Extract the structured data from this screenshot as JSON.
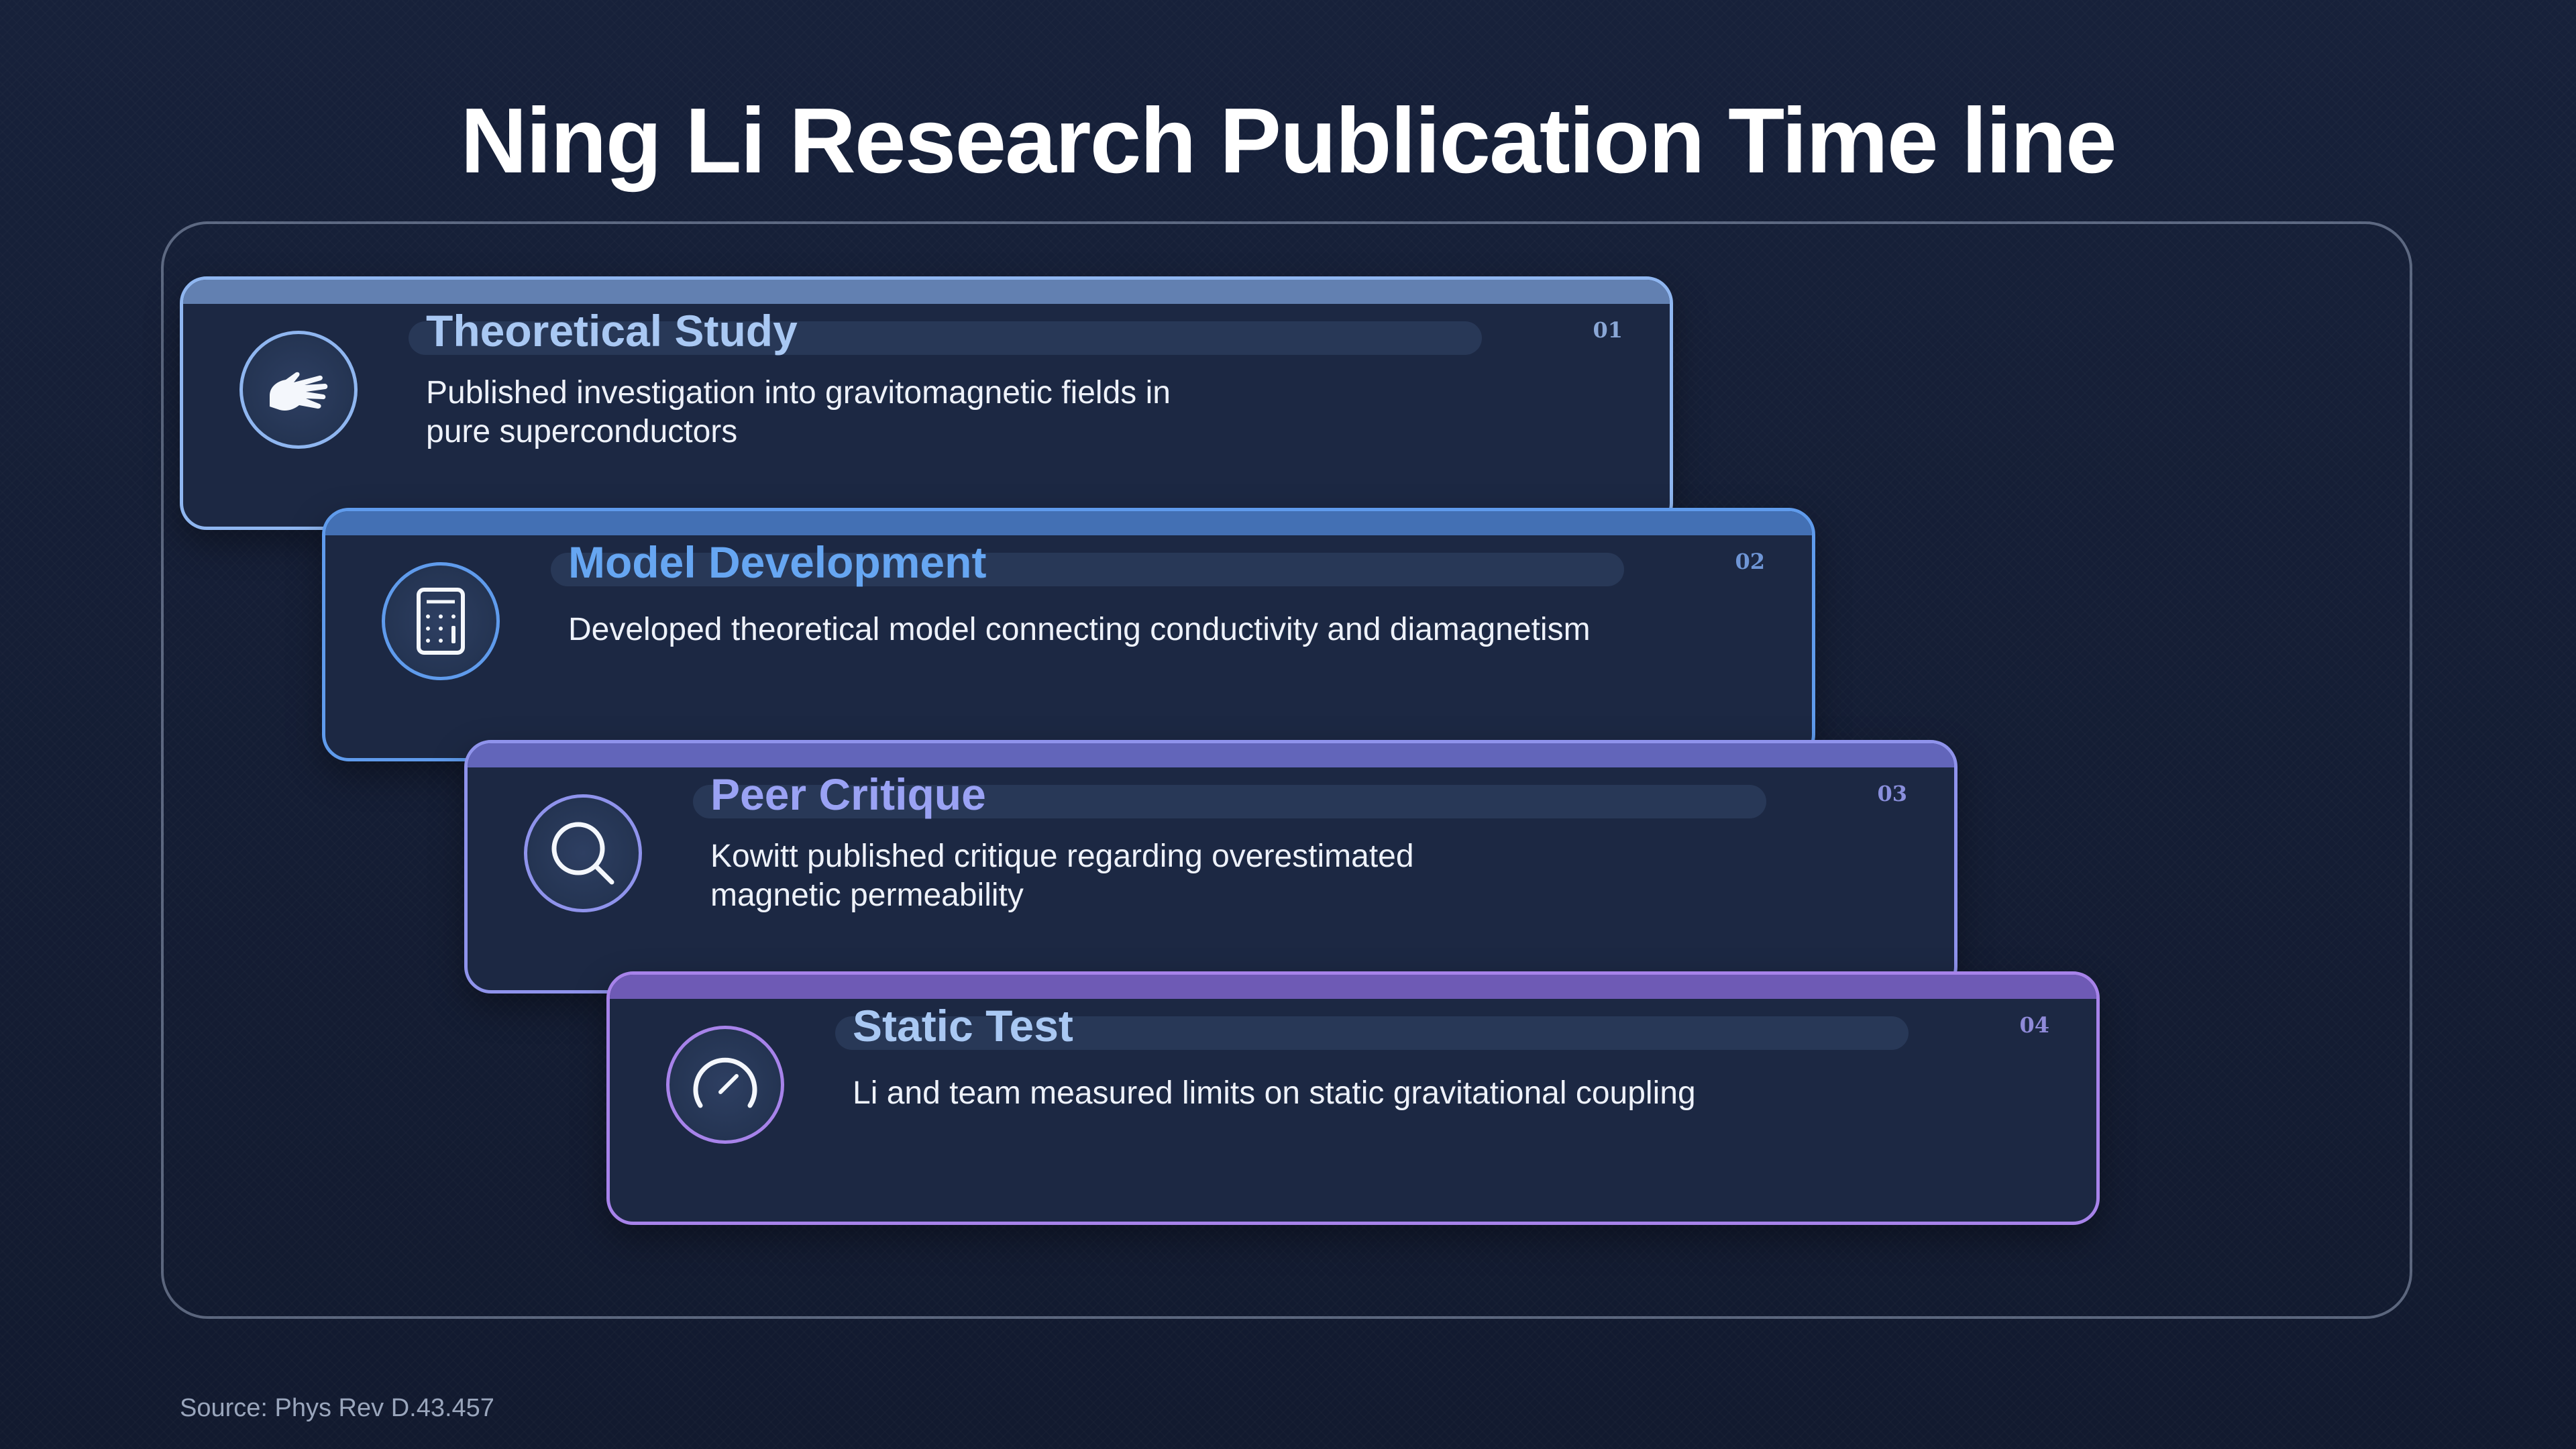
{
  "title": "Ning Li Research Publication Time line",
  "steps": [
    {
      "number": "01",
      "title": "Theoretical Study",
      "description": "Published investigation into gravitomagnetic fields in pure superconductors",
      "icon": "hand-icon",
      "accent": "#8fb6f0"
    },
    {
      "number": "02",
      "title": "Model Development",
      "description": "Developed theoretical model connecting conductivity and diamagnetism",
      "icon": "calculator-icon",
      "accent": "#5f9bec"
    },
    {
      "number": "03",
      "title": "Peer Critique",
      "description": "Kowitt published critique regarding overestimated magnetic permeability",
      "icon": "magnifier-icon",
      "accent": "#8f93ec"
    },
    {
      "number": "04",
      "title": "Static Test",
      "description": "Li and team measured limits on static gravitational coupling",
      "icon": "gauge-icon",
      "accent": "#a783ea"
    }
  ],
  "source": "Source: Phys Rev D.43.457"
}
